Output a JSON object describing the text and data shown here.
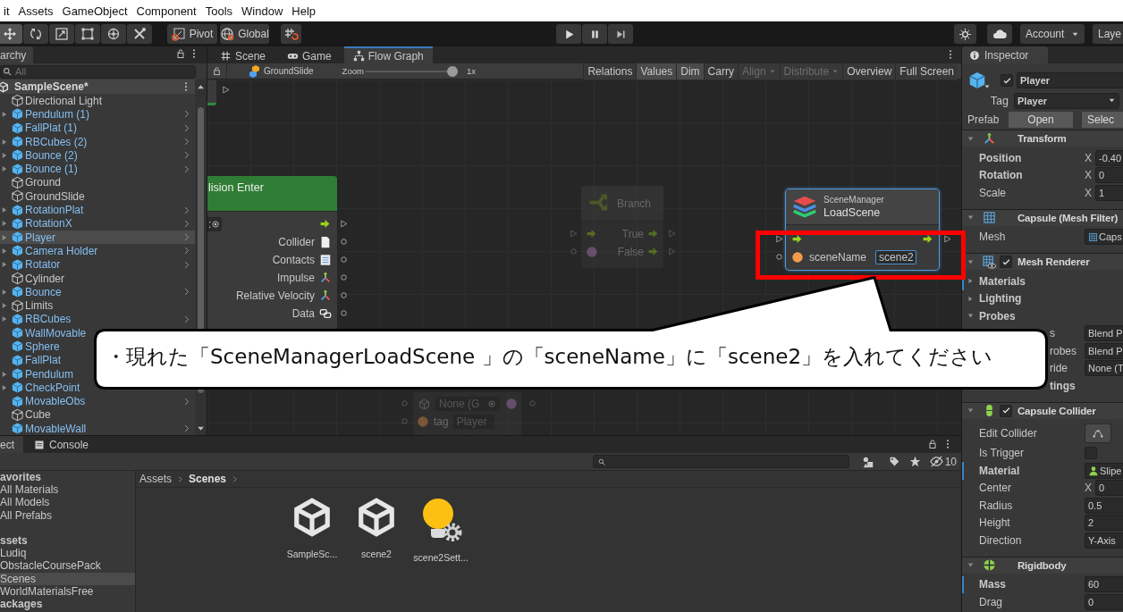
{
  "menu_bar": [
    "it",
    "Assets",
    "GameObject",
    "Component",
    "Tools",
    "Window",
    "Help"
  ],
  "toolbar": {
    "tools": [
      {
        "selected": true
      },
      {
        "selected": false
      },
      {
        "selected": false
      },
      {
        "selected": false
      },
      {
        "selected": false
      },
      {
        "selected": false
      }
    ],
    "pivot": "Pivot",
    "space": "Global",
    "account": "Account",
    "layers": "Laye"
  },
  "hierarchy": {
    "tab": "archy",
    "search_placeholder": "All",
    "scene": "SampleScene*",
    "items": [
      {
        "name": "Directional Light",
        "kind": "object",
        "expandable": false,
        "chevron": false,
        "selected": false
      },
      {
        "name": "Pendulum (1)",
        "kind": "prefab",
        "expandable": true,
        "chevron": true,
        "selected": false
      },
      {
        "name": "FallPlat (1)",
        "kind": "prefab",
        "expandable": false,
        "chevron": true,
        "selected": false
      },
      {
        "name": "RBCubes (2)",
        "kind": "prefab",
        "expandable": true,
        "chevron": true,
        "selected": false
      },
      {
        "name": "Bounce (2)",
        "kind": "prefab",
        "expandable": true,
        "chevron": true,
        "selected": false
      },
      {
        "name": "Bounce (1)",
        "kind": "prefab",
        "expandable": true,
        "chevron": true,
        "selected": false
      },
      {
        "name": "Ground",
        "kind": "object",
        "expandable": false,
        "chevron": false,
        "selected": false
      },
      {
        "name": "GroundSlide",
        "kind": "object",
        "expandable": false,
        "chevron": false,
        "selected": false
      },
      {
        "name": "RotationPlat",
        "kind": "prefab",
        "expandable": true,
        "chevron": true,
        "selected": false
      },
      {
        "name": "RotationX",
        "kind": "prefab",
        "expandable": true,
        "chevron": true,
        "selected": false
      },
      {
        "name": "Player",
        "kind": "prefab",
        "expandable": true,
        "chevron": true,
        "selected": true
      },
      {
        "name": "Camera Holder",
        "kind": "prefab",
        "expandable": true,
        "chevron": true,
        "selected": false
      },
      {
        "name": "Rotator",
        "kind": "prefab",
        "expandable": true,
        "chevron": true,
        "selected": false
      },
      {
        "name": "Cylinder",
        "kind": "object",
        "expandable": false,
        "chevron": false,
        "selected": false
      },
      {
        "name": "Bounce",
        "kind": "prefab",
        "expandable": true,
        "chevron": true,
        "selected": false
      },
      {
        "name": "Limits",
        "kind": "object",
        "expandable": true,
        "chevron": false,
        "selected": false
      },
      {
        "name": "RBCubes",
        "kind": "prefab",
        "expandable": true,
        "chevron": true,
        "selected": false
      },
      {
        "name": "WallMovable",
        "kind": "prefab",
        "expandable": false,
        "chevron": false,
        "selected": false
      },
      {
        "name": "Sphere",
        "kind": "prefab",
        "expandable": false,
        "chevron": false,
        "selected": false
      },
      {
        "name": "FallPlat",
        "kind": "prefab",
        "expandable": false,
        "chevron": false,
        "selected": false
      },
      {
        "name": "Pendulum",
        "kind": "prefab",
        "expandable": true,
        "chevron": false,
        "selected": false
      },
      {
        "name": "CheckPoint",
        "kind": "prefab",
        "expandable": true,
        "chevron": false,
        "selected": false
      },
      {
        "name": "MovableObs",
        "kind": "prefab",
        "expandable": false,
        "chevron": true,
        "selected": false
      },
      {
        "name": "Cube",
        "kind": "object",
        "expandable": false,
        "chevron": false,
        "selected": false
      },
      {
        "name": "MovableWall",
        "kind": "prefab",
        "expandable": false,
        "chevron": true,
        "selected": false
      }
    ]
  },
  "graph": {
    "tabs": [
      {
        "label": "Scene",
        "selected": false
      },
      {
        "label": "Game",
        "selected": false
      },
      {
        "label": "Flow Graph",
        "selected": true
      }
    ],
    "toolbar": {
      "target": "GroundSlide",
      "zoom_label": "Zoom",
      "zoom": {
        "level": 1
      },
      "zoom_reading": "1x",
      "buttons": [
        {
          "label": "Relations",
          "on": false,
          "disabled": false,
          "dropdown": false
        },
        {
          "label": "Values",
          "on": true,
          "disabled": false,
          "dropdown": false
        },
        {
          "label": "Dim",
          "on": true,
          "disabled": false,
          "dropdown": false
        },
        {
          "label": "Carry",
          "on": false,
          "disabled": false,
          "dropdown": false
        },
        {
          "label": "Align",
          "on": false,
          "disabled": true,
          "dropdown": true
        },
        {
          "label": "Distribute",
          "on": false,
          "disabled": true,
          "dropdown": true
        },
        {
          "label": "Overview",
          "on": false,
          "disabled": false,
          "dropdown": false
        },
        {
          "label": "Full Screen",
          "on": false,
          "disabled": false,
          "dropdown": false
        }
      ]
    },
    "nodes": [
      {
        "kind": "stub",
        "selected": false,
        "dimmed": false
      },
      {
        "kind": "event",
        "title": "lision Enter",
        "self_field": ":",
        "selected": false,
        "dimmed": false,
        "outputs": [
          "Collider",
          "Contacts",
          "Impulse",
          "Relative Velocity",
          "Data"
        ]
      },
      {
        "kind": "branch",
        "title": "Branch",
        "selected": false,
        "dimmed": true,
        "outputs": [
          "True",
          "False"
        ]
      },
      {
        "kind": "unit",
        "category": "SceneManager",
        "title": "LoadScene",
        "selected": true,
        "dimmed": false,
        "inputs": [
          {
            "label": "sceneName",
            "value": "scene2"
          }
        ]
      },
      {
        "kind": "getter",
        "target": "None (G",
        "selected": false,
        "dimmed": true,
        "inputs": [
          {
            "label": "tag",
            "value": "Player"
          }
        ]
      }
    ]
  },
  "inspector": {
    "tab": "Inspector",
    "object": {
      "active": true,
      "name": "Player",
      "tag_label": "Tag",
      "tag": "Player",
      "prefab_label": "Prefab",
      "prefab_buttons": [
        "Open",
        "Selec"
      ]
    },
    "components": [
      {
        "title": "Transform",
        "expanded": true,
        "rows": [
          {
            "label": "Position",
            "bold": true,
            "overridden": false,
            "kind": "vector",
            "axis": "X",
            "value": "-0.40"
          },
          {
            "label": "Rotation",
            "bold": true,
            "overridden": false,
            "kind": "vector",
            "axis": "X",
            "value": "0"
          },
          {
            "label": "Scale",
            "bold": false,
            "overridden": false,
            "kind": "vector",
            "axis": "X",
            "value": "1"
          }
        ]
      },
      {
        "title": "Capsule (Mesh Filter)",
        "expanded": true,
        "rows": [
          {
            "label": "Mesh",
            "bold": false,
            "overridden": false,
            "kind": "object",
            "value": "Caps"
          }
        ]
      },
      {
        "title": "Mesh Renderer",
        "enabled": true,
        "expanded": true,
        "rows": [
          {
            "label": "Materials",
            "bold": true,
            "overridden": true,
            "kind": "foldout",
            "expanded": false
          },
          {
            "label": "Lighting",
            "bold": true,
            "overridden": false,
            "kind": "foldout",
            "expanded": false
          },
          {
            "label": "Probes",
            "bold": true,
            "overridden": false,
            "kind": "foldout",
            "expanded": true
          },
          {
            "label": "s",
            "bold": false,
            "overridden": false,
            "kind": "partial",
            "value": "Blend P"
          },
          {
            "label": "robes",
            "bold": false,
            "overridden": false,
            "kind": "partial",
            "value": "Blend P"
          },
          {
            "label": "ride",
            "bold": false,
            "overridden": false,
            "kind": "partial",
            "value": "None (T"
          },
          {
            "label": "tings",
            "bold": true,
            "overridden": false,
            "kind": "partial"
          }
        ]
      },
      {
        "title": "Capsule Collider",
        "enabled": true,
        "expanded": true,
        "rows": [
          {
            "label": "Edit Collider",
            "bold": false,
            "overridden": false,
            "kind": "button"
          },
          {
            "label": "Is Trigger",
            "bold": false,
            "overridden": false,
            "kind": "checkbox",
            "checked": false
          },
          {
            "label": "Material",
            "bold": true,
            "overridden": true,
            "kind": "object",
            "value": "Slipe"
          },
          {
            "label": "Center",
            "bold": false,
            "overridden": false,
            "kind": "vector",
            "axis": "X",
            "value": "0"
          },
          {
            "label": "Radius",
            "bold": false,
            "overridden": false,
            "kind": "field",
            "value": "0.5"
          },
          {
            "label": "Height",
            "bold": false,
            "overridden": false,
            "kind": "field",
            "value": "2"
          },
          {
            "label": "Direction",
            "bold": false,
            "overridden": false,
            "kind": "dropdown",
            "value": "Y-Axis"
          }
        ]
      },
      {
        "title": "Rigidbody",
        "expanded": true,
        "rows": [
          {
            "label": "Mass",
            "bold": true,
            "overridden": true,
            "kind": "field",
            "value": "60"
          },
          {
            "label": "Drag",
            "bold": false,
            "overridden": false,
            "kind": "field",
            "value": "0"
          }
        ]
      }
    ]
  },
  "project": {
    "tabs": [
      {
        "label": "ect",
        "selected": true
      },
      {
        "label": "Console",
        "selected": false
      }
    ],
    "hidden_count": "10",
    "sections": [
      {
        "title": "avorites",
        "items": [
          {
            "label": "All Materials",
            "selected": false
          },
          {
            "label": "All Models",
            "selected": false
          },
          {
            "label": "All Prefabs",
            "selected": false
          }
        ]
      },
      {
        "title": "ssets",
        "items": [
          {
            "label": "Ludiq",
            "selected": false
          },
          {
            "label": "ObstacleCoursePack",
            "selected": false
          },
          {
            "label": "Scenes",
            "selected": true
          },
          {
            "label": "WorldMaterialsFree",
            "selected": false
          }
        ]
      },
      {
        "title": "ackages"
      }
    ],
    "breadcrumb": [
      {
        "label": "Assets",
        "current": false
      },
      {
        "label": "Scenes",
        "current": true
      }
    ],
    "assets": [
      {
        "name": "SampleSc...",
        "kind": "scene"
      },
      {
        "name": "scene2",
        "kind": "scene"
      },
      {
        "name": "scene2Sett...",
        "kind": "lighting"
      }
    ]
  },
  "callout": {
    "text": "・現れた「SceneManagerLoadScene 」の「sceneName」に「scene2」を入れてください"
  }
}
